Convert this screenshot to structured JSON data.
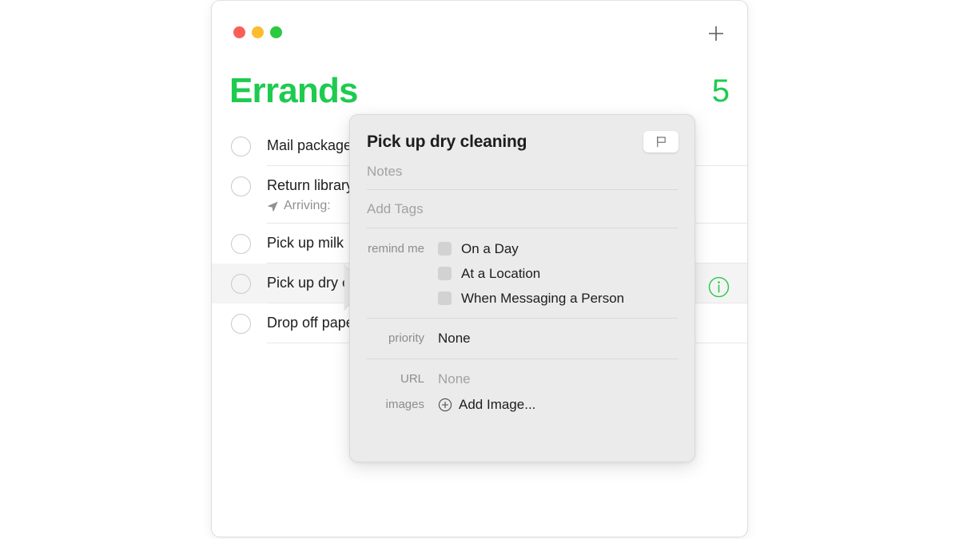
{
  "window": {
    "traffic_lights": [
      {
        "name": "close",
        "color": "#fb5f57"
      },
      {
        "name": "minimize",
        "color": "#fcbc2d"
      },
      {
        "name": "zoom",
        "color": "#2ac940"
      }
    ],
    "add_button_icon": "plus-icon"
  },
  "list": {
    "title": "Errands",
    "count": "5",
    "accent_color": "#1ecb4f",
    "items": [
      {
        "title": "Mail package",
        "subtitle": null,
        "selected": false,
        "completed": false
      },
      {
        "title": "Return library books",
        "subtitle": "Arriving:",
        "subtitle_icon": "location-arrow-icon",
        "selected": false,
        "completed": false
      },
      {
        "title": "Pick up milk",
        "subtitle": null,
        "selected": false,
        "completed": false
      },
      {
        "title": "Pick up dry cleaning",
        "subtitle": null,
        "selected": true,
        "completed": false
      },
      {
        "title": "Drop off paperwork",
        "subtitle": null,
        "selected": false,
        "completed": false
      }
    ]
  },
  "info_button": {
    "icon": "info-circle-icon",
    "color": "#2ac94a"
  },
  "popover": {
    "title": "Pick up dry cleaning",
    "flag_button_icon": "flag-icon",
    "notes_placeholder": "Notes",
    "tags_placeholder": "Add Tags",
    "remind_me": {
      "label": "remind me",
      "options": [
        {
          "label": "On a Day",
          "checked": false
        },
        {
          "label": "At a Location",
          "checked": false
        },
        {
          "label": "When Messaging a Person",
          "checked": false
        }
      ]
    },
    "priority": {
      "label": "priority",
      "value": "None"
    },
    "url": {
      "label": "URL",
      "value": "None"
    },
    "images": {
      "label": "images",
      "action_label": "Add Image...",
      "action_icon": "plus-circle-icon"
    }
  }
}
